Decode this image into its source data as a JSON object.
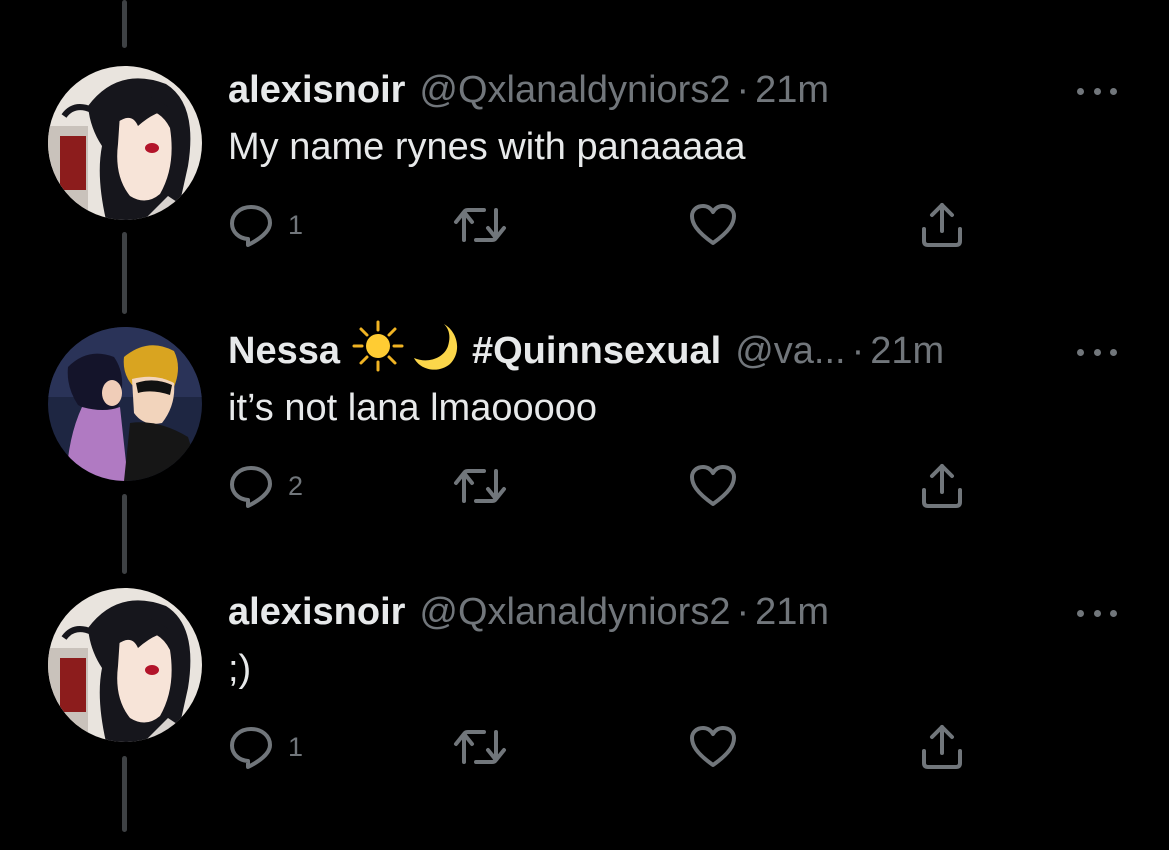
{
  "colors": {
    "background": "#000000",
    "primary_text": "#e7e9ea",
    "secondary_text": "#71767b",
    "thread_line": "#3e4144"
  },
  "tweets": [
    {
      "display_name": "alexisnoir",
      "handle": "@Qxlanaldyniors2",
      "separator": "·",
      "time": "21m",
      "text": "My name rynes with panaaaaa",
      "reply_count": "1",
      "avatar": "anime-girl-avatar",
      "icons": [
        "reply-icon",
        "retweet-icon",
        "like-icon",
        "share-icon",
        "more-icon"
      ]
    },
    {
      "display_name": "Nessa",
      "name_emojis": [
        "☀️",
        "🌙"
      ],
      "name_suffix": "#Quinnsexual",
      "handle": "@va...",
      "separator": "·",
      "time": "21m",
      "text": "it’s not lana lmaooooo",
      "reply_count": "2",
      "avatar": "couple-kiss-avatar",
      "icons": [
        "reply-icon",
        "retweet-icon",
        "like-icon",
        "share-icon",
        "more-icon"
      ]
    },
    {
      "display_name": "alexisnoir",
      "handle": "@Qxlanaldyniors2",
      "separator": "·",
      "time": "21m",
      "text": ";)",
      "reply_count": "1",
      "avatar": "anime-girl-avatar",
      "icons": [
        "reply-icon",
        "retweet-icon",
        "like-icon",
        "share-icon",
        "more-icon"
      ]
    }
  ]
}
